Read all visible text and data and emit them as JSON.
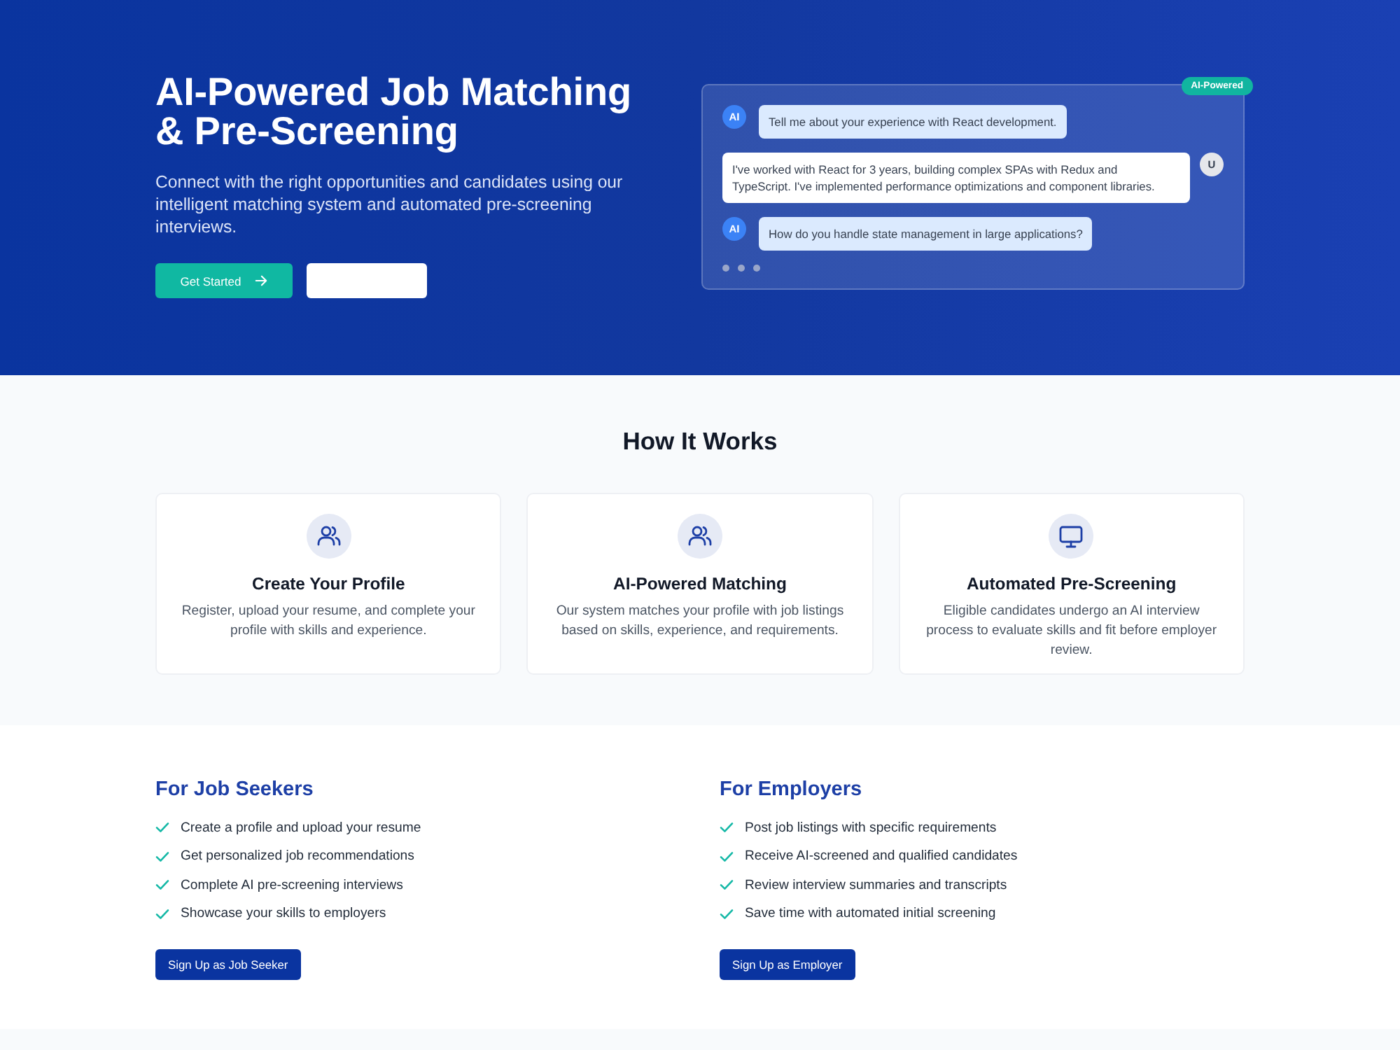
{
  "hero": {
    "title": "AI-Powered Job Matching & Pre-Screening",
    "subtitle": "Connect with the right opportunities and candidates using our intelligent matching system and automated pre-screening interviews.",
    "buttons": [
      {
        "kind": "primary",
        "label": "Get Started"
      },
      {
        "kind": "blank"
      }
    ]
  },
  "chat_preview": {
    "badge": "AI-Powered",
    "messages": [
      {
        "kind": "ai",
        "avatar": "AI",
        "text": "Tell me about your experience with React development."
      },
      {
        "kind": "user",
        "avatar": "U",
        "text": "I've worked with React for 3 years, building complex SPAs with Redux and TypeScript. I've implemented performance optimizations and component libraries."
      },
      {
        "kind": "ai",
        "avatar": "AI",
        "text": "How do you handle state management in large applications?"
      }
    ],
    "typing": true
  },
  "how_it_works": {
    "title": "How It Works",
    "steps": [
      {
        "title": "Create Your Profile",
        "description": "Register, upload your resume, and complete your profile with skills and experience."
      },
      {
        "title": "AI-Powered Matching",
        "description": "Our system matches your profile with job listings based on skills, experience, and requirements."
      },
      {
        "title": "Automated Pre-Screening",
        "description": "Eligible candidates undergo an AI interview process to evaluate skills and fit before employer review."
      }
    ]
  },
  "audiences": [
    {
      "title": "For Job Seekers",
      "items": [
        "Create a profile and upload your resume",
        "Get personalized job recommendations",
        "Complete AI pre-screening interviews",
        "Showcase your skills to employers"
      ],
      "button": "Sign Up as Job Seeker"
    },
    {
      "title": "For Employers",
      "items": [
        "Post job listings with specific requirements",
        "Receive AI-screened and qualified candidates",
        "Review interview summaries and transcripts",
        "Save time with automated initial screening"
      ],
      "button": "Sign Up as Employer"
    }
  ]
}
